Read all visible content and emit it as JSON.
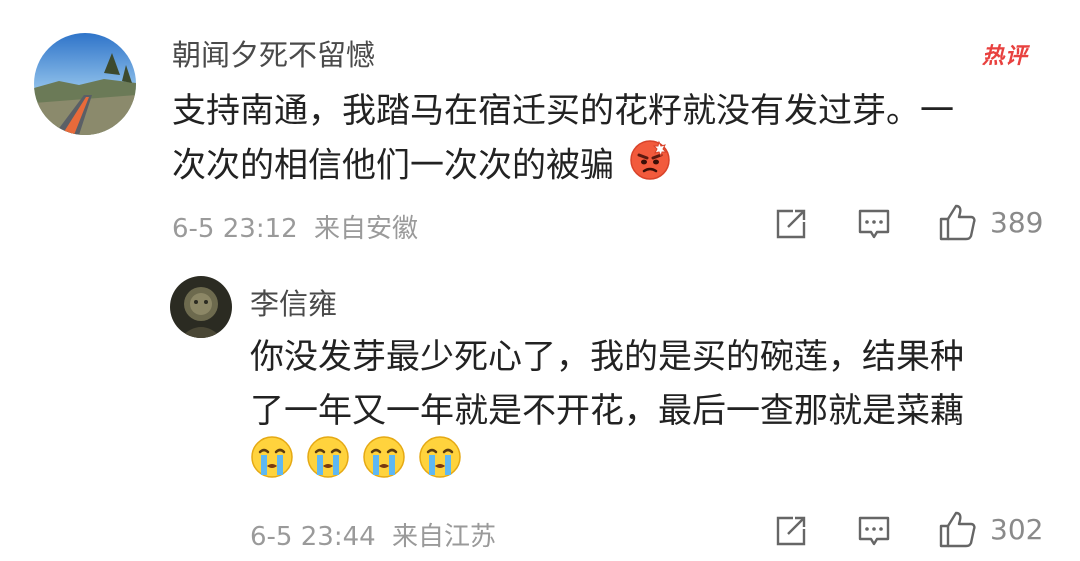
{
  "comment": {
    "username": "朝闻夕死不留憾",
    "badge": "热评",
    "text_line1": "支持南通，我踏马在宿迁买的花籽就没有发过芽。一",
    "text_line2": "次次的相信他们一次次的被骗",
    "date": "6-5 23:12",
    "location": "来自安徽",
    "likes": "389",
    "emoji": "angry-face"
  },
  "reply": {
    "username": "李信雍",
    "text_line1": "你没发芽最少死心了，我的是买的碗莲，结果种",
    "text_line2": "了一年又一年就是不开花，最后一查那就是菜藕",
    "emojis": [
      "crying-face",
      "crying-face",
      "crying-face",
      "crying-face"
    ],
    "date": "6-5 23:44",
    "location": "来自江苏",
    "likes": "302"
  }
}
